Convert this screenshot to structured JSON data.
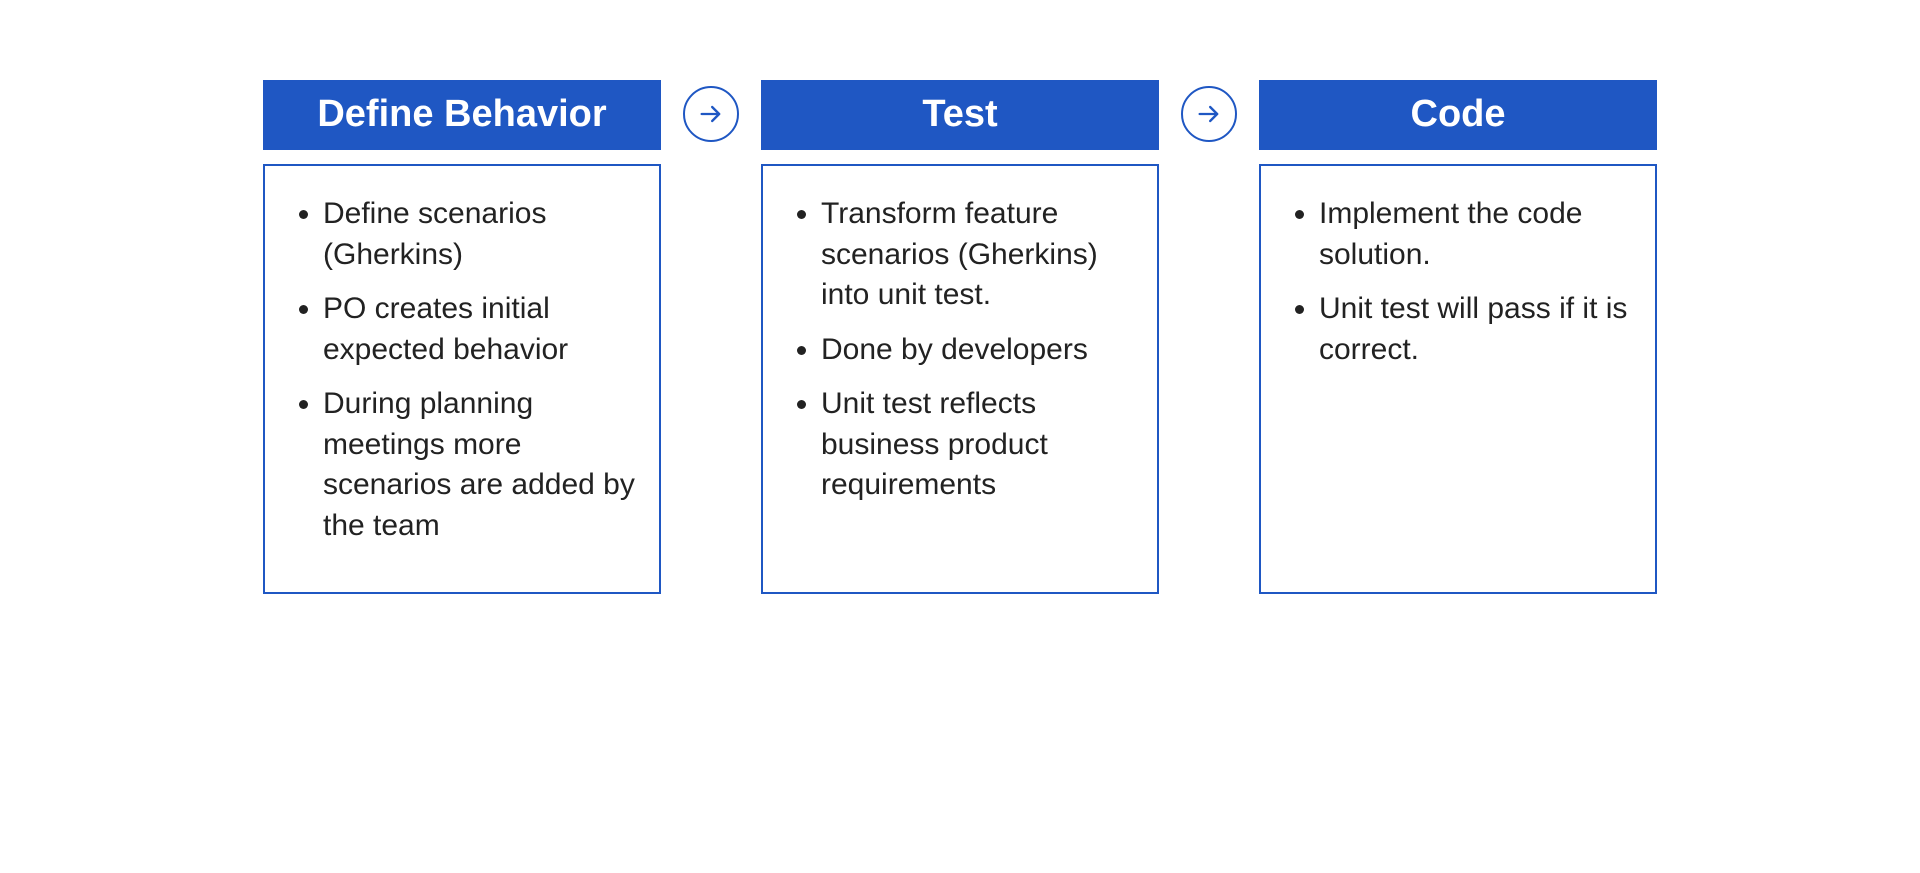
{
  "colors": {
    "brand": "#1f57c3",
    "text": "#1a1a1a",
    "bg": "#ffffff"
  },
  "steps": [
    {
      "title": "Define Behavior",
      "items": [
        "Define scenarios (Gherkins)",
        "PO creates initial expected behavior",
        "During planning meetings more scenarios are added by the team"
      ]
    },
    {
      "title": "Test",
      "items": [
        "Transform feature scenarios (Gherkins) into unit test.",
        "Done by developers",
        "Unit test reflects business product requirements"
      ]
    },
    {
      "title": "Code",
      "items": [
        "Implement the code solution.",
        "Unit test will pass if it is correct."
      ]
    }
  ],
  "icons": {
    "arrow_right": "arrow-right-icon"
  }
}
